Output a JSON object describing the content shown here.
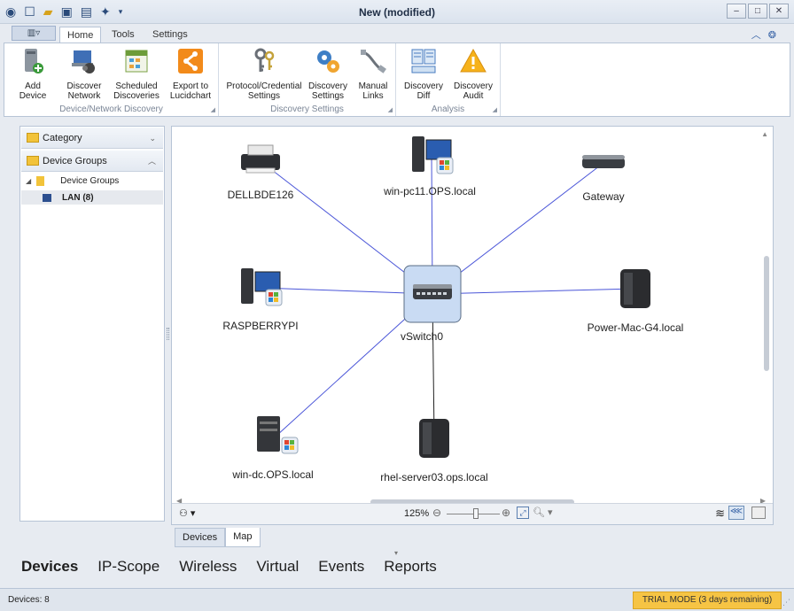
{
  "window": {
    "title": "New (modified)"
  },
  "ribbon": {
    "tabs": [
      "Home",
      "Tools",
      "Settings"
    ],
    "groups": [
      {
        "label": "Device/Network Discovery",
        "buttons": [
          {
            "line1": "Add Device",
            "line2": ""
          },
          {
            "line1": "Discover",
            "line2": "Network"
          },
          {
            "line1": "Scheduled",
            "line2": "Discoveries"
          },
          {
            "line1": "Export to",
            "line2": "Lucidchart"
          }
        ]
      },
      {
        "label": "Discovery Settings",
        "buttons": [
          {
            "line1": "Protocol/Credential",
            "line2": "Settings"
          },
          {
            "line1": "Discovery",
            "line2": "Settings"
          },
          {
            "line1": "Manual",
            "line2": "Links"
          }
        ]
      },
      {
        "label": "Analysis",
        "buttons": [
          {
            "line1": "Discovery",
            "line2": "Diff"
          },
          {
            "line1": "Discovery",
            "line2": "Audit"
          }
        ]
      }
    ]
  },
  "left_panel": {
    "category_label": "Category",
    "groups_label": "Device Groups",
    "tree_root": "Device Groups",
    "tree_child": "LAN (8)"
  },
  "map": {
    "center_node": "vSwitch0",
    "nodes": [
      {
        "label": "DELLBDE126",
        "type": "printer"
      },
      {
        "label": "win-pc11.OPS.local",
        "type": "windows-pc"
      },
      {
        "label": "Gateway",
        "type": "router"
      },
      {
        "label": "RASPBERRYPI",
        "type": "windows-pc"
      },
      {
        "label": "Power-Mac-G4.local",
        "type": "server"
      },
      {
        "label": "win-dc.OPS.local",
        "type": "windows-server"
      },
      {
        "label": "rhel-server03.ops.local",
        "type": "server"
      }
    ],
    "zoom": "125%",
    "link_color": "#4a55d8",
    "wired_color": "#222222"
  },
  "view_tabs": [
    "Devices",
    "Map"
  ],
  "active_view_tab": "Map",
  "nav": [
    "Devices",
    "IP-Scope",
    "Wireless",
    "Virtual",
    "Events",
    "Reports"
  ],
  "active_nav": "Devices",
  "status": {
    "devices": "Devices: 8",
    "trial": "TRIAL MODE (3 days remaining)"
  }
}
